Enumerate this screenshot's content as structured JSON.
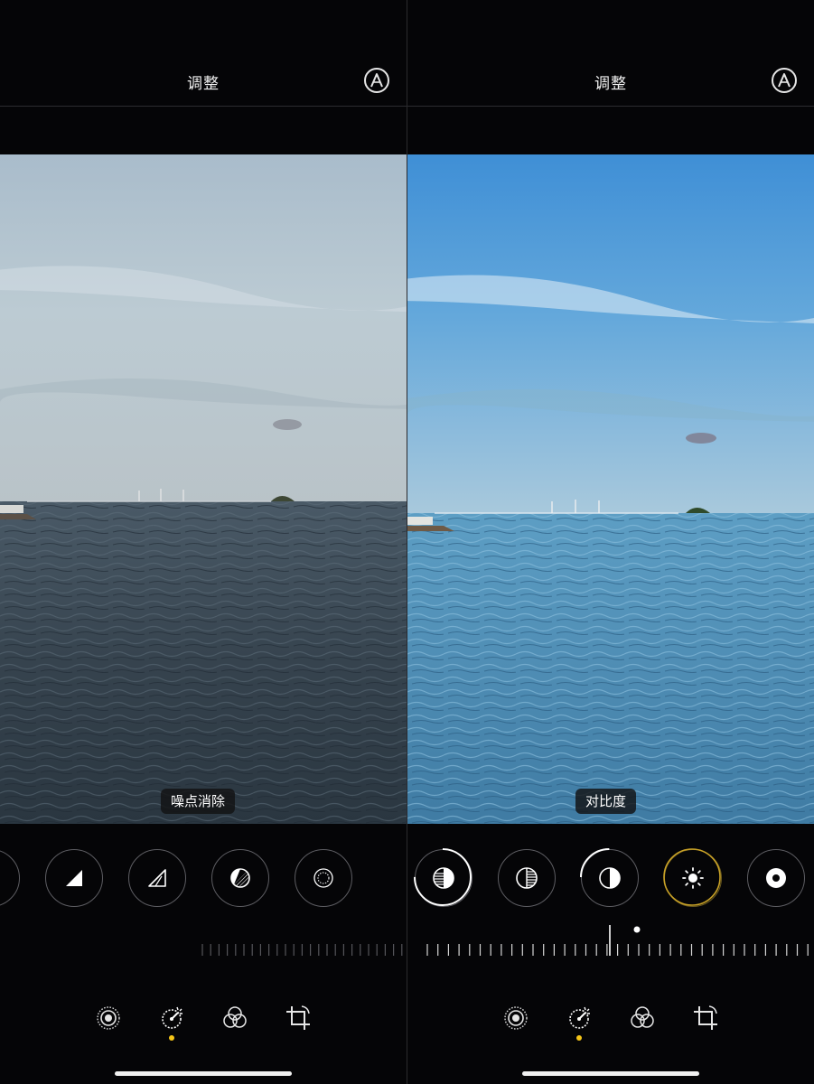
{
  "colors": {
    "background": "#050507",
    "accent": "#f5c518",
    "ring_inactive": "#5d5d62",
    "ring_progress": "#ffffff"
  },
  "panels": [
    {
      "id": "before",
      "header": {
        "title": "调整",
        "auto_icon": "magic-wand-circle-icon"
      },
      "photo": {
        "alt_tone": "muted"
      },
      "active_tool_label": "噪点消除",
      "tools": [
        {
          "icon": "partial-circle-icon",
          "selected": false
        },
        {
          "icon": "sharpness-triangle-icon",
          "selected": false
        },
        {
          "icon": "definition-triangle-icon",
          "selected": false
        },
        {
          "icon": "noise-reduction-circle-icon",
          "selected": false
        },
        {
          "icon": "vignette-circle-icon",
          "selected": false
        }
      ],
      "modes": [
        {
          "icon": "live-photo-icon",
          "active": false
        },
        {
          "icon": "adjust-dial-icon",
          "active": true
        },
        {
          "icon": "filters-icon",
          "active": false
        },
        {
          "icon": "crop-rotate-icon",
          "active": false
        }
      ]
    },
    {
      "id": "after",
      "header": {
        "title": "调整",
        "auto_icon": "magic-wand-circle-icon"
      },
      "photo": {
        "alt_tone": "vivid"
      },
      "active_tool_label": "对比度",
      "tools": [
        {
          "icon": "highlights-circle-icon",
          "selected": false,
          "progress": 0.75
        },
        {
          "icon": "shadows-circle-icon",
          "selected": false
        },
        {
          "icon": "contrast-circle-icon",
          "selected": true,
          "progress": 0.25
        },
        {
          "icon": "brightness-sun-icon",
          "selected": false,
          "accent": true
        },
        {
          "icon": "black-point-circle-icon",
          "selected": false
        }
      ],
      "modes": [
        {
          "icon": "live-photo-icon",
          "active": false
        },
        {
          "icon": "adjust-dial-icon",
          "active": true
        },
        {
          "icon": "filters-icon",
          "active": false
        },
        {
          "icon": "crop-rotate-icon",
          "active": false
        }
      ]
    }
  ]
}
